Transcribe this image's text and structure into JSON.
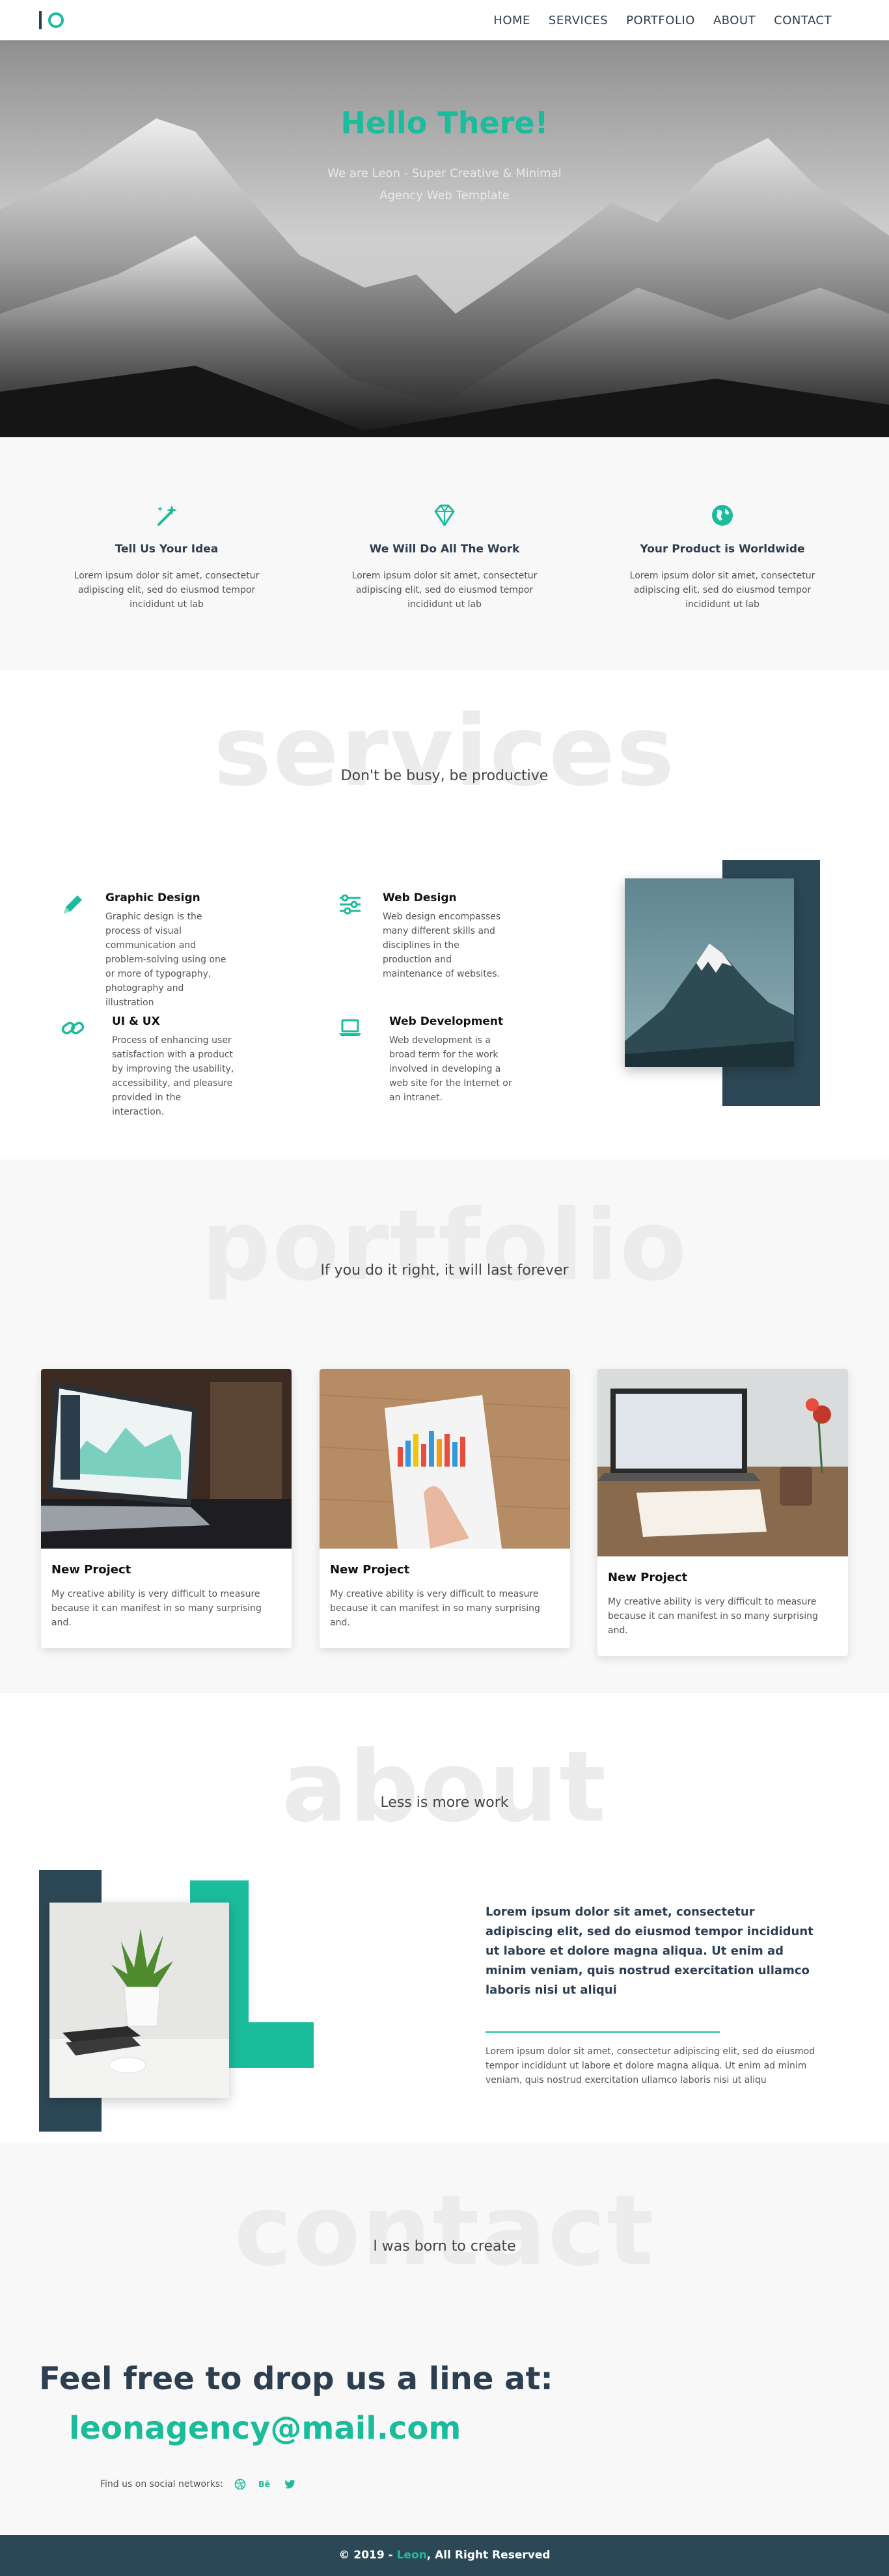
{
  "nav": {
    "items": [
      "HOME",
      "SERVICES",
      "PORTFOLIO",
      "ABOUT",
      "CONTACT"
    ]
  },
  "hero": {
    "title": "Hello There!",
    "subtitle": "We are Leon - Super Creative & Minimal Agency Web Template"
  },
  "features": [
    {
      "icon": "magic-wand-icon",
      "title": "Tell Us Your Idea",
      "text": "Lorem ipsum dolor sit amet, consectetur adipiscing elit, sed do eiusmod tempor incididunt ut lab"
    },
    {
      "icon": "diamond-icon",
      "title": "We Will Do All The Work",
      "text": "Lorem ipsum dolor sit amet, consectetur adipiscing elit, sed do eiusmod tempor incididunt ut lab"
    },
    {
      "icon": "globe-icon",
      "title": "Your Product is Worldwide",
      "text": "Lorem ipsum dolor sit amet, consectetur adipiscing elit, sed do eiusmod tempor incididunt ut lab"
    }
  ],
  "services": {
    "bg_title": "services",
    "tagline": "Don't be busy, be productive",
    "items": [
      {
        "icon": "pencil-icon",
        "title": "Graphic Design",
        "text": "Graphic design is the process of visual communication and problem-solving using one or more of typography, photography and illustration"
      },
      {
        "icon": "sliders-icon",
        "title": "Web Design",
        "text": "Web design encompasses many different skills and disciplines in the production and maintenance of websites."
      },
      {
        "icon": "link-icon",
        "title": "UI & UX",
        "text": "Process of enhancing user satisfaction with a product by improving the usability, accessibility, and pleasure provided in the interaction."
      },
      {
        "icon": "laptop-icon",
        "title": "Web Development",
        "text": "Web development is a broad term for the work involved in developing a web site for the Internet or an intranet."
      }
    ]
  },
  "portfolio": {
    "bg_title": "portfolio",
    "tagline": "If you do it right, it will last forever",
    "cards": [
      {
        "title": "New Project",
        "text": "My creative ability is very difficult to measure because it can manifest in so many surprising and."
      },
      {
        "title": "New Project",
        "text": "My creative ability is very difficult to measure because it can manifest in so many surprising and."
      },
      {
        "title": "New Project",
        "text": "My creative ability is very difficult to measure because it can manifest in so many surprising and."
      }
    ]
  },
  "about": {
    "bg_title": "about",
    "tagline": "Less is more work",
    "bold_text": "Lorem ipsum dolor sit amet, consectetur adipiscing elit, sed do eiusmod tempor incididunt ut labore et dolore magna aliqua. Ut enim ad minim veniam, quis nostrud exercitation ullamco laboris nisi ut aliqui",
    "text": "Lorem ipsum dolor sit amet, consectetur adipiscing elit, sed do eiusmod tempor incididunt ut labore et dolore magna aliqua. Ut enim ad minim veniam, quis nostrud exercitation ullamco laboris nisi ut aliqu"
  },
  "contact": {
    "bg_title": "contact",
    "tagline": "I was born to create",
    "heading": "Feel free to drop us a line at:",
    "email": "leonagency@mail.com",
    "social_label": "Find us on social networks:",
    "socials": [
      "dribbble-icon",
      "behance-icon",
      "twitter-icon"
    ]
  },
  "footer": {
    "prefix": "© 2019 - ",
    "brand": "Leon",
    "suffix": ", All Right Reserved"
  },
  "colors": {
    "accent": "#1abc9c",
    "dark": "#2c4856"
  }
}
